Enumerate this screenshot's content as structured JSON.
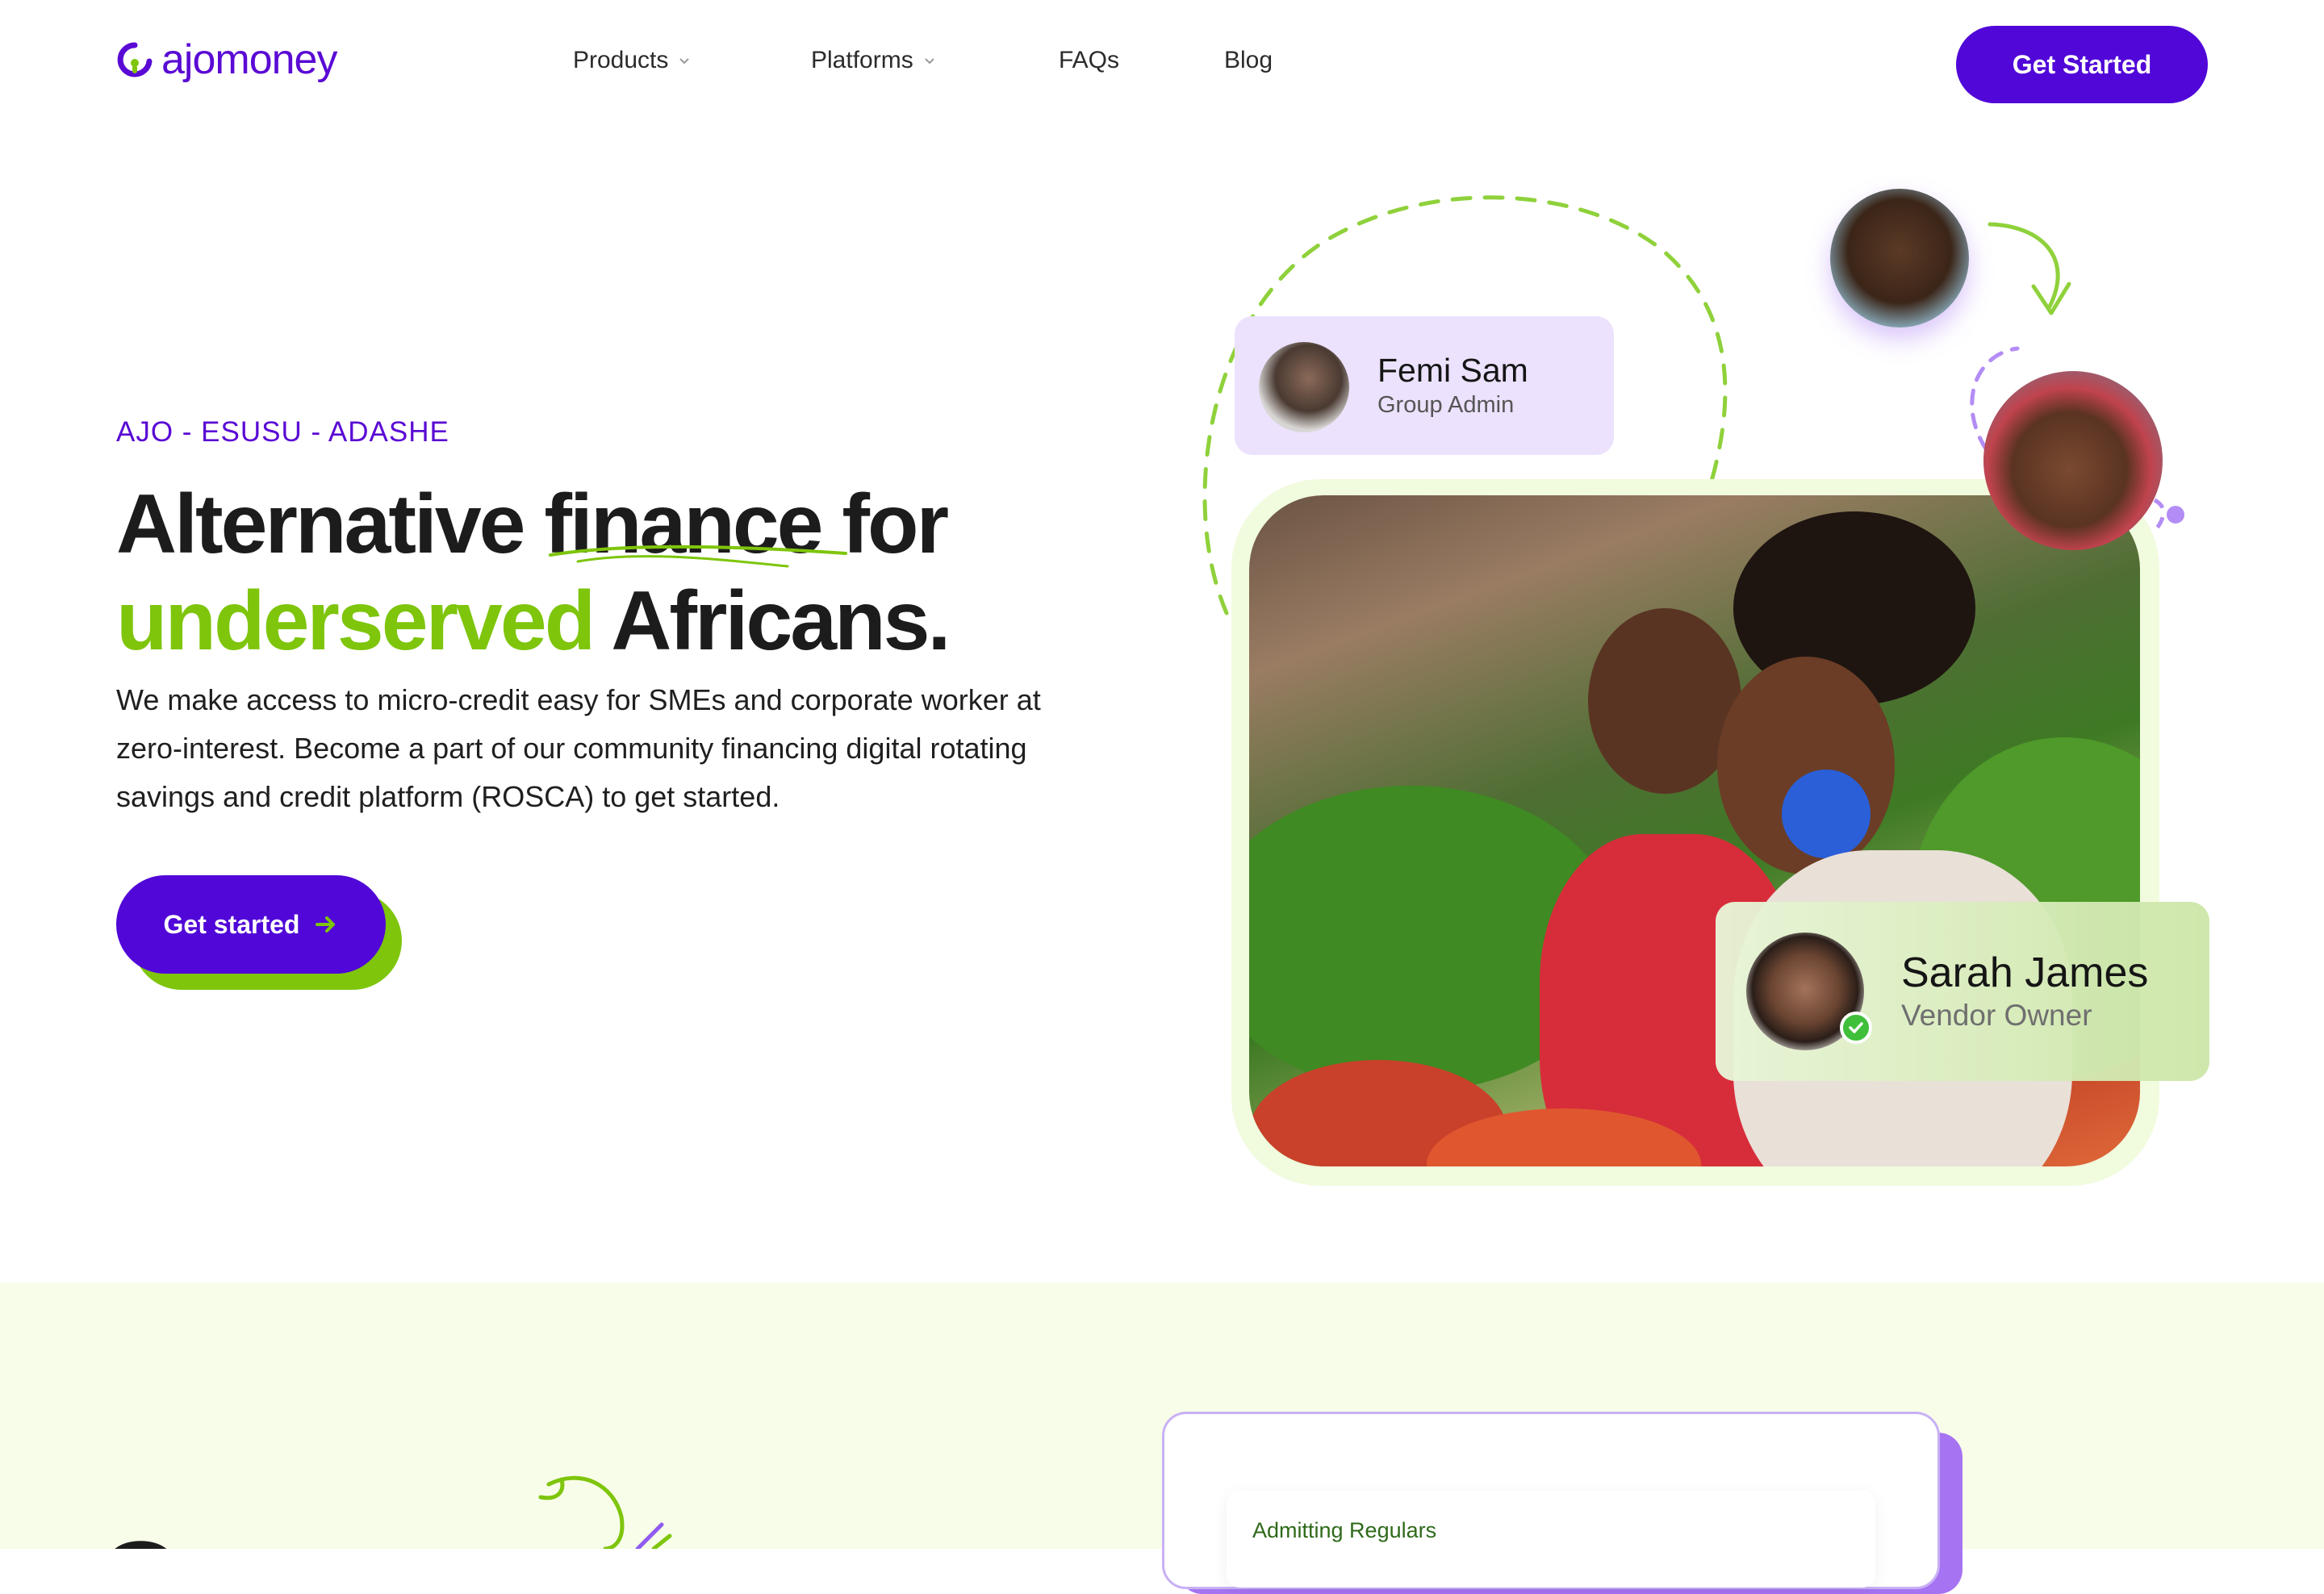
{
  "header": {
    "logo_text": "ajomoney",
    "nav": [
      {
        "label": "Products",
        "has_dropdown": true
      },
      {
        "label": "Platforms",
        "has_dropdown": true
      },
      {
        "label": "FAQs",
        "has_dropdown": false
      },
      {
        "label": "Blog",
        "has_dropdown": false
      }
    ],
    "cta_label": "Get Started"
  },
  "hero": {
    "eyebrow": "AJO - ESUSU - ADASHE",
    "headline": {
      "line1_a": "Alternative ",
      "line1_b": "finance",
      "line1_c": " for",
      "line2_a": "underserved",
      "line2_b": " Africans."
    },
    "description": "We make access to micro-credit easy for SMEs and corporate worker at zero-interest. Become a part of our community financing digital rotating savings and credit platform (ROSCA) to get started.",
    "cta_label": "Get started",
    "cards": [
      {
        "name": "Femi Sam",
        "role": "Group Admin"
      },
      {
        "name": "Sarah James",
        "role": "Vendor Owner"
      }
    ]
  },
  "section2": {
    "heading_partial": "Our mo",
    "panel_label": "Admitting Regulars"
  },
  "colors": {
    "brand_purple": "#5107d8",
    "brand_green": "#7ec50c",
    "card_lavender": "#ece2fd",
    "band_bg": "#f8fde9"
  }
}
